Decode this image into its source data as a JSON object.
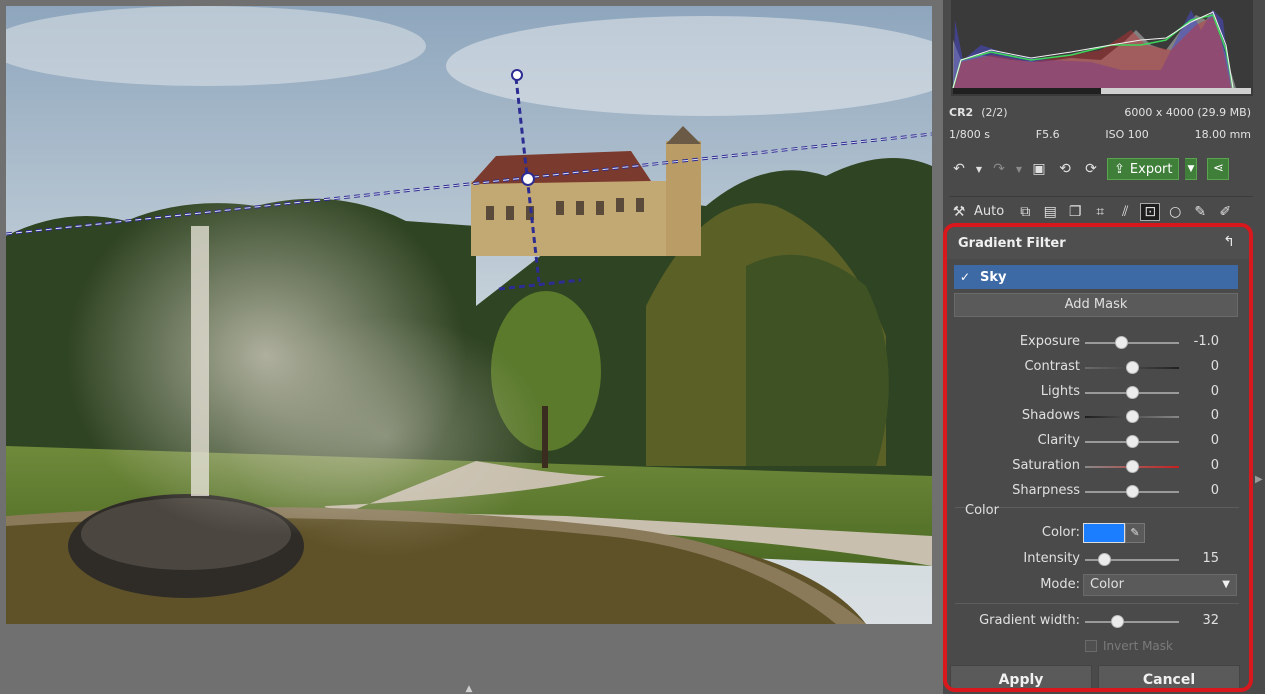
{
  "file": {
    "format": "CR2",
    "index": "(2/2)",
    "dimensions": "6000 x 4000 (29.9 MB)",
    "shutter": "1/800 s",
    "aperture": "F5.6",
    "iso": "ISO 100",
    "focal": "18.00 mm"
  },
  "toolbar": {
    "export_label": "Export",
    "auto_label": "Auto"
  },
  "filter": {
    "title": "Gradient Filter",
    "mask_name": "Sky",
    "mask_checked": "✓",
    "add_mask_label": "Add Mask",
    "sliders": [
      {
        "label": "Exposure",
        "value": "-1.0",
        "level": 0.38
      },
      {
        "label": "Contrast",
        "value": "0",
        "level": 0.5
      },
      {
        "label": "Lights",
        "value": "0",
        "level": 0.5
      },
      {
        "label": "Shadows",
        "value": "0",
        "level": 0.5
      },
      {
        "label": "Clarity",
        "value": "0",
        "level": 0.5
      },
      {
        "label": "Saturation",
        "value": "0",
        "level": 0.5
      },
      {
        "label": "Sharpness",
        "value": "0",
        "level": 0.5
      }
    ],
    "color_section": "Color",
    "color_label": "Color:",
    "color_value": "#1a7eff",
    "intensity": {
      "label": "Intensity",
      "value": "15",
      "level": 0.2
    },
    "mode_label": "Mode:",
    "mode_value": "Color",
    "gradient_width": {
      "label": "Gradient width:",
      "value": "32",
      "level": 0.34
    },
    "invert_label": "Invert Mask",
    "apply_label": "Apply",
    "cancel_label": "Cancel"
  },
  "colors": {
    "accent_export": "#3f7f3a",
    "selection": "#3d6aa5",
    "highlight_border": "#d8181c"
  }
}
